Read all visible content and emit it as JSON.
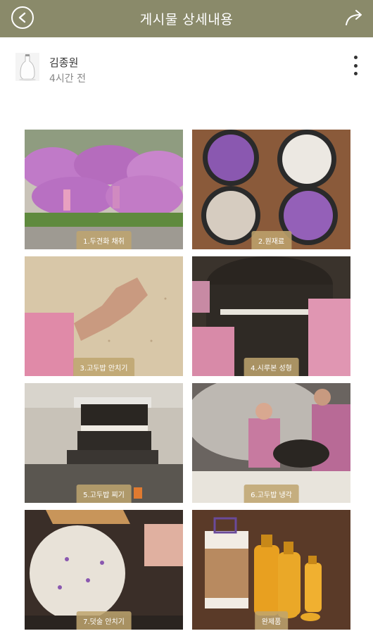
{
  "header": {
    "title": "게시물 상세내용",
    "bg_color": "#8a8a6a"
  },
  "author": {
    "name": "김종원",
    "time": "4시간 전"
  },
  "gallery": [
    {
      "caption": "1.두견화 채취"
    },
    {
      "caption": "2.원재료"
    },
    {
      "caption": "3.고두밥 안치기"
    },
    {
      "caption": "4.시루본 성형"
    },
    {
      "caption": "5.고두밥 찌기"
    },
    {
      "caption": "6.고두밥 냉각"
    },
    {
      "caption": "7.덧술 안치기"
    },
    {
      "caption": "완제품"
    }
  ]
}
